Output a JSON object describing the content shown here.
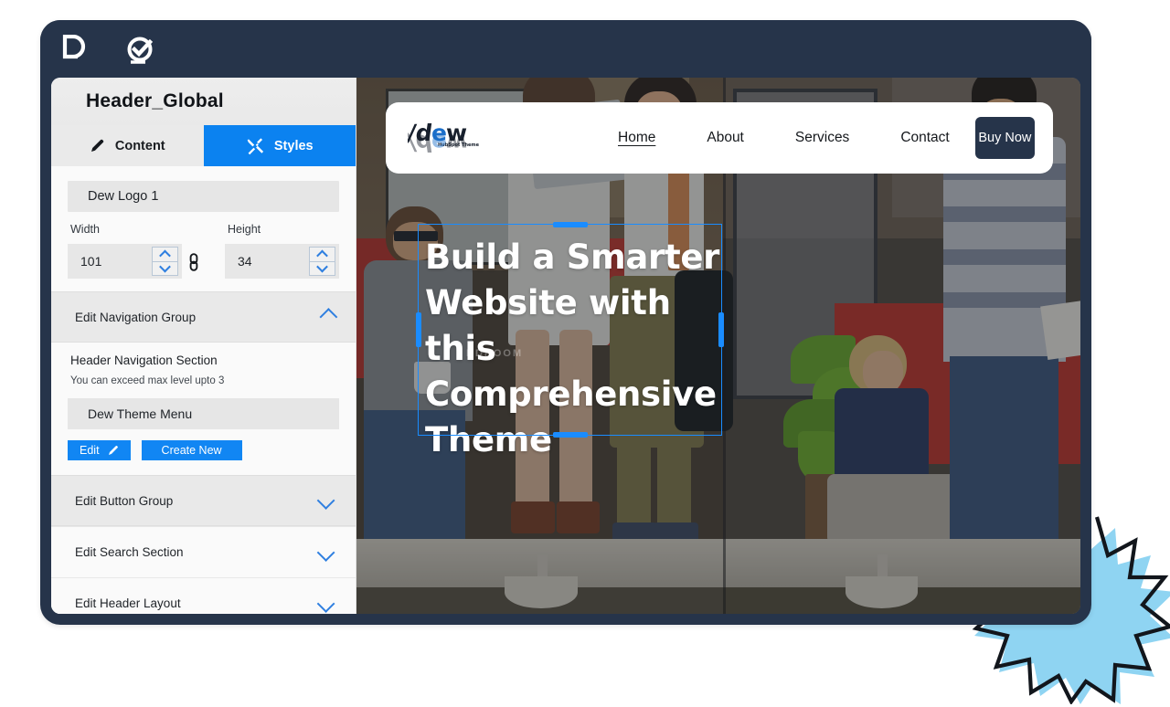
{
  "frame": {
    "topbar_icons": [
      {
        "name": "brand-mark-icon",
        "label": "D"
      },
      {
        "name": "check-circle-icon",
        "label": "Q"
      }
    ],
    "frame_color": "#26344a"
  },
  "sidebar": {
    "title": "Header_Global",
    "tabs": [
      {
        "id": "content",
        "label": "Content",
        "icon": "pencil-icon",
        "active": false
      },
      {
        "id": "styles",
        "label": "Styles",
        "icon": "tools-icon",
        "active": true
      }
    ],
    "active_tab_color": "#0b82f0",
    "logo_field": {
      "name_label": "Dew Logo 1",
      "width_label": "Width",
      "width_value": "101",
      "height_label": "Height",
      "height_value": "34",
      "link_icon": "chain-link-icon"
    },
    "sections": [
      {
        "id": "nav-group",
        "label": "Edit Navigation Group",
        "expanded": true,
        "caret": "chevron-up-icon"
      },
      {
        "id": "button-group",
        "label": "Edit Button Group",
        "expanded": false,
        "caret": "chevron-down-icon"
      },
      {
        "id": "search",
        "label": "Edit Search Section",
        "expanded": false,
        "caret": "chevron-down-icon"
      },
      {
        "id": "layout",
        "label": "Edit Header Layout",
        "expanded": false,
        "caret": "chevron-down-icon"
      }
    ],
    "nav_panel": {
      "heading": "Header Navigation Section",
      "hint": "You can exceed max level upto 3",
      "menu_value": "Dew Theme Menu",
      "edit_button": "Edit",
      "edit_icon": "pencil-icon",
      "create_button": "Create New",
      "button_color": "#1186f3"
    }
  },
  "preview": {
    "site_nav": {
      "logo_alt": "dew",
      "links": [
        {
          "label": "Home",
          "active": true
        },
        {
          "label": "About",
          "active": false
        },
        {
          "label": "Services",
          "active": false
        },
        {
          "label": "Contact",
          "active": false
        }
      ],
      "cta": {
        "label": "Buy Now",
        "color": "#26344a"
      }
    },
    "hero": {
      "headline": "Build a Smarter Website with this Comprehensive Theme",
      "watermark": "RDROOM",
      "selection_color": "#1a8cff",
      "selected": true
    }
  },
  "decoration": {
    "starburst_fill": "#8fd4f2",
    "starburst_stroke": "#12161c"
  }
}
